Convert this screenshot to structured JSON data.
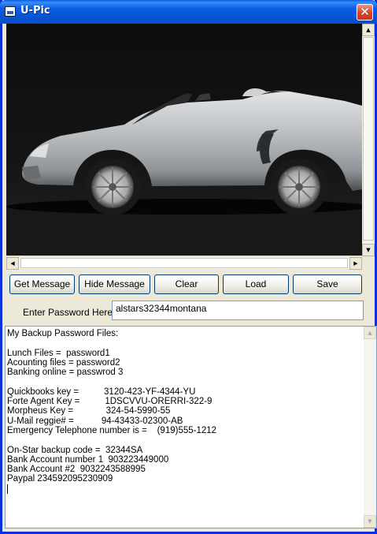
{
  "window": {
    "title": "U-Pic",
    "close": "✕"
  },
  "scroll": {
    "up": "▲",
    "down": "▼",
    "left": "◀",
    "right": "▶"
  },
  "buttons": {
    "get_message": "Get Message",
    "hide_message": "Hide Message",
    "clear": "Clear",
    "load": "Load",
    "save": "Save"
  },
  "password": {
    "label": "Enter Password Here :",
    "value": "alstars32344montana"
  },
  "notes": {
    "lines": [
      "My Backup Password Files:",
      "",
      "Lunch Files =  password1",
      "Acounting files = password2",
      "Banking online = passwrod 3",
      "",
      "Quickbooks key =          3120-423-YF-4344-YU",
      "Forte Agent Key =          1DSCVVU-ORERRI-322-9",
      "Morpheus Key =             324-54-5990-55",
      "U-Mail reggie# =           94-43433-02300-AB",
      "Emergency Telephone number is =    (919)555-1212",
      "",
      "On-Star backup code =  32344SA",
      "Bank Account number 1  903223449000",
      "Bank Account #2  9032243588995",
      "Paypal 234592095230909"
    ]
  },
  "colors": {
    "car_body": "#b9bcbf",
    "window_bg": "#ece9d8",
    "titlebar": "#0a5ee8"
  }
}
